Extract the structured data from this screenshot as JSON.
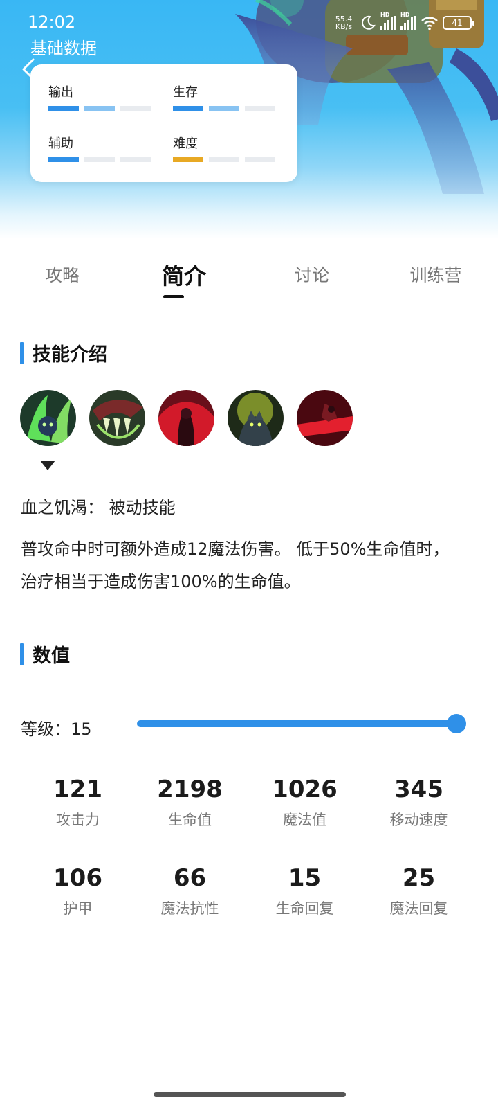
{
  "status_bar": {
    "time": "12:02",
    "net_speed_value": "55.4",
    "net_speed_unit": "KB/s",
    "battery": "41"
  },
  "header": {
    "title": "基础数据",
    "attributes": [
      {
        "label": "输出",
        "level": 2,
        "max": 3,
        "color": "#2f90e8"
      },
      {
        "label": "生存",
        "level": 2,
        "max": 3,
        "color": "#2f90e8"
      },
      {
        "label": "辅助",
        "level": 1,
        "max": 3,
        "color": "#2f90e8"
      },
      {
        "label": "难度",
        "level": 1,
        "max": 3,
        "color": "#e8a924"
      }
    ]
  },
  "tabs": [
    "攻略",
    "简介",
    "讨论",
    "训练营"
  ],
  "active_tab": 1,
  "skills_section": {
    "title": "技能介绍",
    "icon_names": [
      "skill-1-icon",
      "skill-2-icon",
      "skill-3-icon",
      "skill-4-icon",
      "skill-5-icon"
    ],
    "selected_name": "血之饥渴：  被动技能",
    "selected_desc": "普攻命中时可额外造成12魔法伤害。 低于50%生命值时，治疗相当于造成伤害100%的生命值。"
  },
  "stats_section": {
    "title": "数值",
    "level_label": "等级：15",
    "level_fraction": 1.0,
    "items": [
      {
        "value": "121",
        "label": "攻击力"
      },
      {
        "value": "2198",
        "label": "生命值"
      },
      {
        "value": "1026",
        "label": "魔法值"
      },
      {
        "value": "345",
        "label": "移动速度"
      },
      {
        "value": "106",
        "label": "护甲"
      },
      {
        "value": "66",
        "label": "魔法抗性"
      },
      {
        "value": "15",
        "label": "生命回复"
      },
      {
        "value": "25",
        "label": "魔法回复"
      }
    ]
  },
  "colors": {
    "accent": "#2f90e8",
    "difficulty": "#e8a924"
  }
}
